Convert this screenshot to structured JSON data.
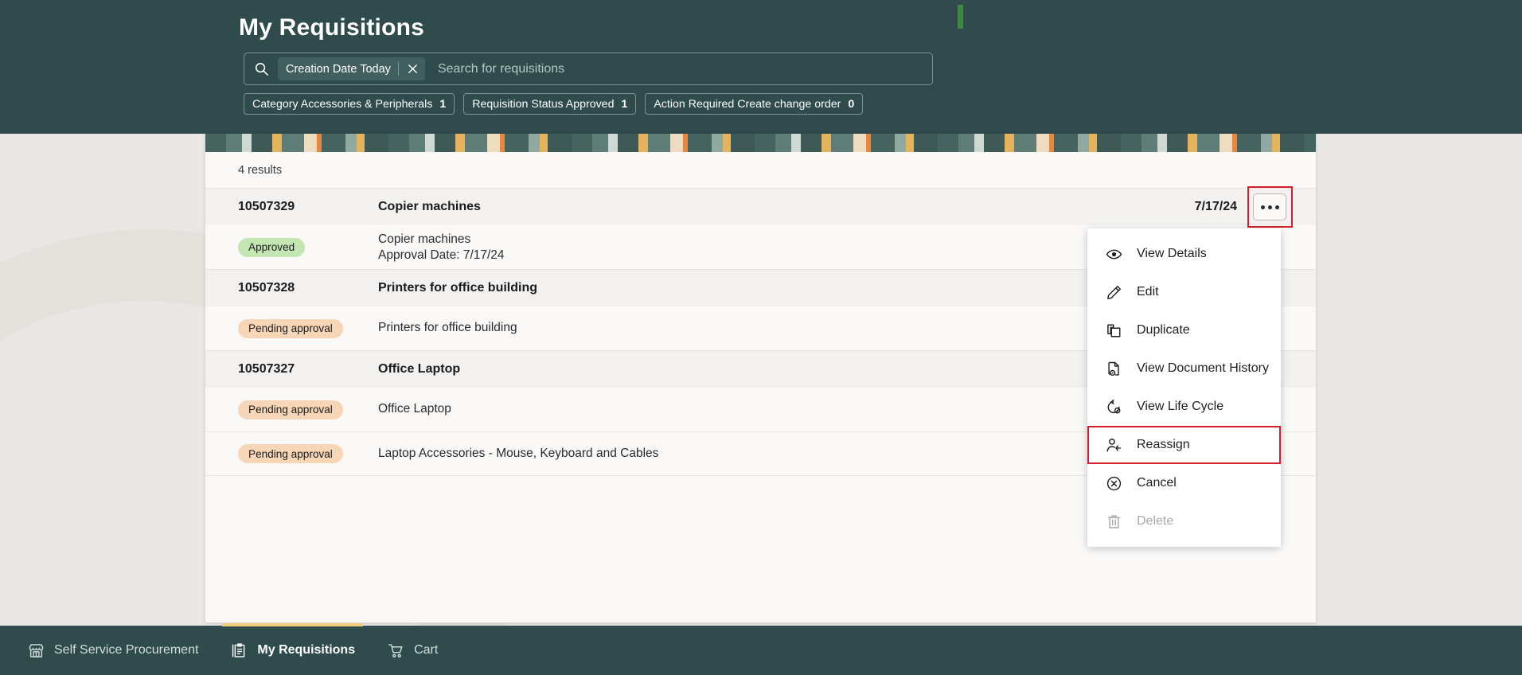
{
  "header": {
    "title": "My Requisitions"
  },
  "search": {
    "icon": "search-icon",
    "token_label": "Creation Date Today",
    "token_clear_icon": "close-icon",
    "placeholder": "Search for requisitions"
  },
  "filter_chips": [
    {
      "label": "Category Accessories & Peripherals",
      "count": "1"
    },
    {
      "label": "Requisition Status Approved",
      "count": "1"
    },
    {
      "label": "Action Required Create change order",
      "count": "0"
    }
  ],
  "results": {
    "count_label": "4 results",
    "groups": [
      {
        "id": "10507329",
        "title": "Copier machines",
        "date": "7/17/24",
        "more_button_icon": "ellipsis-icon",
        "lines": [
          {
            "status": "Approved",
            "status_kind": "approved",
            "text": "Copier machines",
            "sub": "Approval Date: 7/17/24"
          }
        ]
      },
      {
        "id": "10507328",
        "title": "Printers for office building",
        "date": "",
        "lines": [
          {
            "status": "Pending approval",
            "status_kind": "pending",
            "text": "Printers for office building",
            "sub": ""
          }
        ]
      },
      {
        "id": "10507327",
        "title": "Office Laptop",
        "date": "",
        "lines": [
          {
            "status": "Pending approval",
            "status_kind": "pending",
            "text": "Office Laptop",
            "sub": ""
          },
          {
            "status": "Pending approval",
            "status_kind": "pending",
            "text": "Laptop Accessories - Mouse, Keyboard and Cables",
            "sub": ""
          }
        ]
      }
    ]
  },
  "context_menu": {
    "items": [
      {
        "label": "View Details",
        "icon": "eye-icon",
        "disabled": false,
        "selected": false
      },
      {
        "label": "Edit",
        "icon": "pencil-icon",
        "disabled": false,
        "selected": false
      },
      {
        "label": "Duplicate",
        "icon": "copy-icon",
        "disabled": false,
        "selected": false
      },
      {
        "label": "View Document History",
        "icon": "document-eye-icon",
        "disabled": false,
        "selected": false
      },
      {
        "label": "View Life Cycle",
        "icon": "lifecycle-icon",
        "disabled": false,
        "selected": false
      },
      {
        "label": "Reassign",
        "icon": "user-arrow-icon",
        "disabled": false,
        "selected": true
      },
      {
        "label": "Cancel",
        "icon": "circle-x-icon",
        "disabled": false,
        "selected": false
      },
      {
        "label": "Delete",
        "icon": "trash-icon",
        "disabled": true,
        "selected": false
      }
    ]
  },
  "bottom_nav": {
    "items": [
      {
        "label": "Self Service Procurement",
        "icon": "storefront-icon",
        "active": false
      },
      {
        "label": "My Requisitions",
        "icon": "clipboard-icon",
        "active": true
      },
      {
        "label": "Cart",
        "icon": "cart-icon",
        "active": false
      }
    ]
  },
  "colors": {
    "brand_teal": "#2f4b4b",
    "accent_yellow": "#f2d07b",
    "highlight_red": "#d71f2b",
    "status_approved_bg": "#c3e6b2",
    "status_pending_bg": "#f6d6b6"
  }
}
